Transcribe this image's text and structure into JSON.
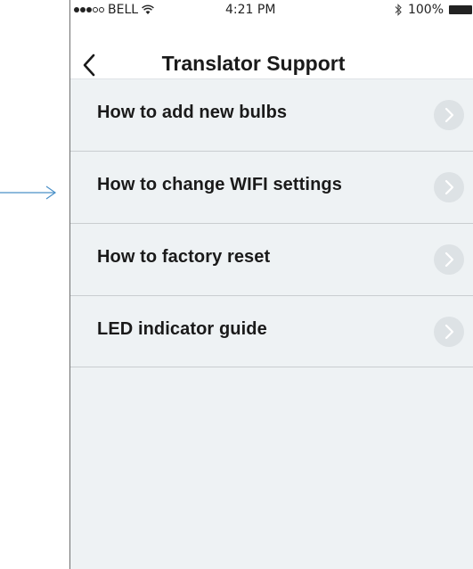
{
  "status_bar": {
    "carrier": "BELL",
    "signal_bars_filled": 3,
    "signal_bars_total": 5,
    "wifi_icon": "wifi-icon",
    "time": "4:21 PM",
    "bluetooth_icon": "bluetooth-icon",
    "battery": "100%",
    "battery_icon": "battery-icon"
  },
  "nav": {
    "back_icon": "chevron-left-icon",
    "title": "Translator Support"
  },
  "menu": {
    "items": [
      {
        "label": "How to add new bulbs",
        "icon": "chevron-right-icon"
      },
      {
        "label": "How to change WIFI settings",
        "icon": "chevron-right-icon"
      },
      {
        "label": "How to factory reset",
        "icon": "chevron-right-icon"
      },
      {
        "label": "LED indicator guide",
        "icon": "chevron-right-icon"
      }
    ]
  },
  "annotation": {
    "icon": "arrow-right-icon",
    "color": "#4a90c8"
  },
  "colors": {
    "background": "#eef2f4",
    "bar_background": "#ffffff",
    "divider": "#c9cdd0",
    "chevron_circle": "#dde2e5",
    "chevron": "#ffffff",
    "text": "#1a1a1a"
  }
}
